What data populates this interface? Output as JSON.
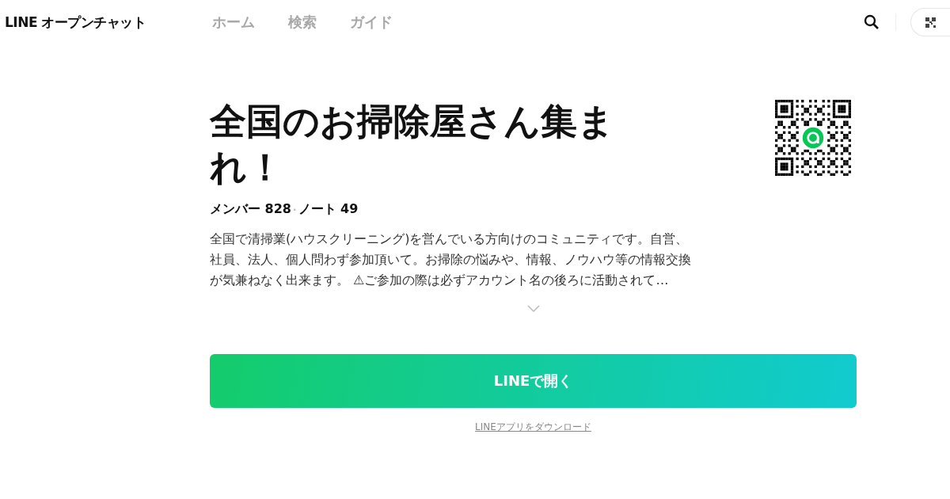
{
  "header": {
    "logo": "LINE オープンチャット",
    "nav": [
      {
        "label": "ホーム",
        "selected": false
      },
      {
        "label": "検索",
        "selected": false
      },
      {
        "label": "ガイド",
        "selected": false
      }
    ]
  },
  "room": {
    "title": "全国のお掃除屋さん集まれ！",
    "members": "メンバー 828",
    "separator": "·",
    "notes": "ノート 49",
    "description": "全国で清掃業(ハウスクリーニング)を営んでいる方向けのコミュニティです。自営、社員、法人、個人問わず参加頂いて。お掃除の悩みや、情報、ノウハウ等の情報交換が気兼ねなく出来ます。 ⚠ご参加の際は必ずアカウント名の後ろに活動されて…"
  },
  "open_button": "LINEで開く",
  "download_link": "LINEアプリをダウンロード"
}
